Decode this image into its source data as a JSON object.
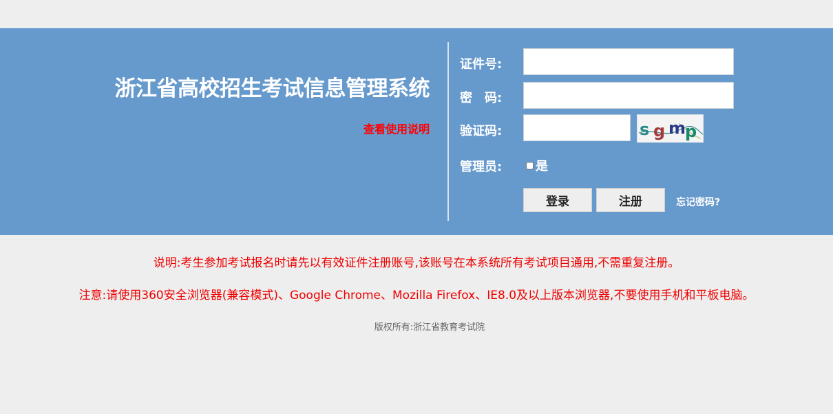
{
  "header": {
    "system_title": "浙江省高校招生考试信息管理系统",
    "help_link": "查看使用说明"
  },
  "login_form": {
    "id_label": "证件号:",
    "id_value": "",
    "password_label": "密　码:",
    "password_value": "",
    "captcha_label": "验证码:",
    "captcha_value": "",
    "captcha_text": "sgmp",
    "admin_label": "管理员:",
    "admin_option": "是",
    "admin_checked": false,
    "login_button": "登录",
    "register_button": "注册",
    "forgot_link": "忘记密码?"
  },
  "notices": {
    "explanation": "说明:考生参加考试报名时请先以有效证件注册账号,该账号在本系统所有考试项目通用,不需重复注册。",
    "attention": "注意:请使用360安全浏览器(兼容模式)、Google Chrome、Mozilla Firefox、IE8.0及以上版本浏览器,不要使用手机和平板电脑。"
  },
  "footer": {
    "copyright": "版权所有:浙江省教育考试院"
  },
  "colors": {
    "banner": "#6699cc",
    "page_background": "#eeeeee",
    "notice_text": "#ee0000",
    "help_link": "#ff0000"
  }
}
